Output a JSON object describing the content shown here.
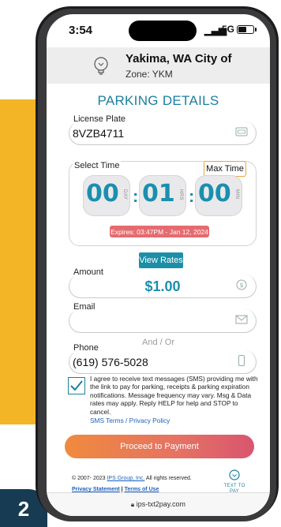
{
  "status_bar": {
    "time": "3:54",
    "network": "5G"
  },
  "header": {
    "city": "Yakima, WA City of",
    "zone": "Zone: YKM"
  },
  "section_title": "PARKING DETAILS",
  "license_plate": {
    "label": "License Plate",
    "value": "8VZB4711"
  },
  "select_time": {
    "label": "Select Time",
    "max_time_label": "Max Time",
    "days": "00",
    "days_unit": "DAY",
    "hours": "01",
    "hours_unit": "HRS",
    "minutes": "00",
    "minutes_unit": "MIN",
    "expires": "Expires: 03:47PM - Jan 12, 2024"
  },
  "view_rates_label": "View Rates",
  "amount": {
    "label": "Amount",
    "value": "$1.00"
  },
  "email": {
    "label": "Email",
    "value": ""
  },
  "and_or": "And / Or",
  "phone": {
    "label": "Phone",
    "value": "(619) 576-5028"
  },
  "consent": {
    "checked": true,
    "text": "I agree to receive text messages (SMS) providing me with the link to pay for parking, receipts & parking expiration notifications. Message frequency may vary. Msg & Data rates may apply. Reply HELP for help and STOP to cancel.",
    "sms_terms": "SMS Terms",
    "separator": "/",
    "privacy_policy": "Privacy Policy"
  },
  "proceed_label": "Proceed to Payment",
  "footer": {
    "copyright_prefix": "© 2007- 2023",
    "company": "IPS Group, Inc.",
    "rights": "All rights reserved.",
    "privacy_statement": "Privacy Statement",
    "divider": "|",
    "terms_of_use": "Terms of Use",
    "logo_text": "TEXT TO PAY"
  },
  "url_bar": {
    "url": "ips-txt2pay.com"
  },
  "step_number": "2",
  "colors": {
    "accent": "#1b7fa0",
    "brand_yellow": "#f3b526",
    "badge": "#173b52",
    "expires_bg": "#e56b6f"
  }
}
